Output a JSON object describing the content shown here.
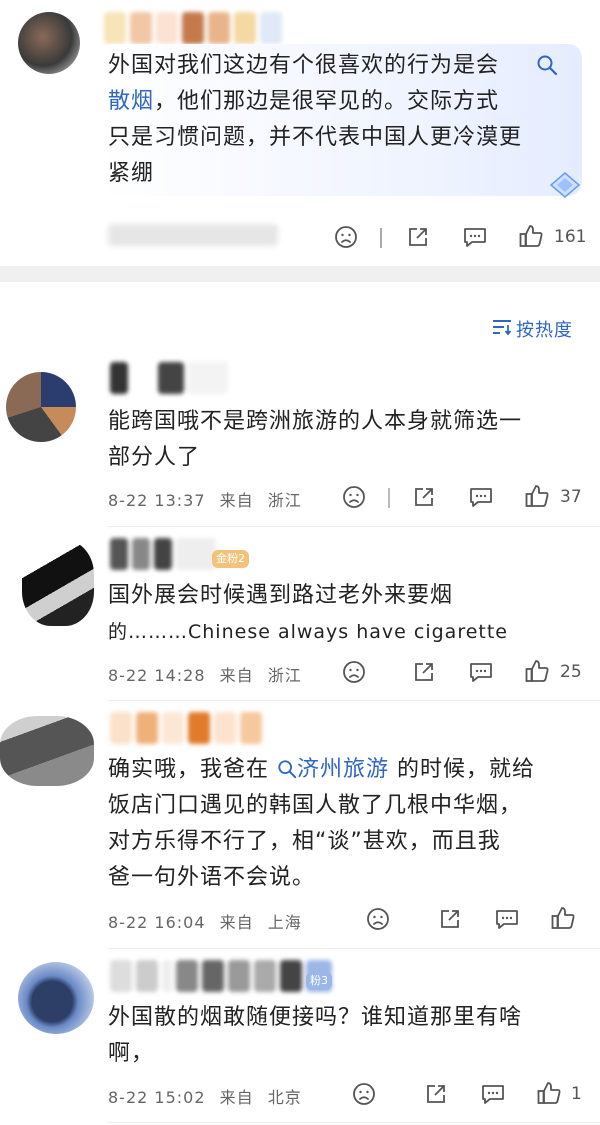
{
  "top_comment": {
    "text_line1": "外国对我们这边有个很喜欢的行为是会",
    "link_text": "散烟",
    "text_line2_rest": "，他们那边是很罕见的。交际方式",
    "text_line3": "只是习惯问题，并不代表中国人更冷漠更",
    "text_line4": "紧绷",
    "like_count": "161"
  },
  "sort": {
    "label": "按热度"
  },
  "comments": [
    {
      "line1": "能跨国哦不是跨洲旅游的人本身就筛选一",
      "line2": "部分人了",
      "date": "8-22 13:37",
      "from_label": "来自",
      "location": "浙江",
      "likes": "37"
    },
    {
      "badge": "金粉2",
      "line1": "国外展会时候遇到路过老外来要烟",
      "line2": "的………Chinese always have cigarette",
      "date": "8-22 14:28",
      "from_label": "来自",
      "location": "浙江",
      "likes": "25"
    },
    {
      "line1_prefix": "确实哦，我爸在",
      "link_text": "济州旅游",
      "line1_suffix": "的时候，就给",
      "line2": "饭店门口遇见的韩国人散了几根中华烟，",
      "line3": "对方乐得不行了，相“谈”甚欢，而且我",
      "line4": "爸一句外语不会说。",
      "date": "8-22 16:04",
      "from_label": "来自",
      "location": "上海",
      "likes": ""
    },
    {
      "badge": "粉3",
      "line1": "外国散的烟敢随便接吗？谁知道那里有啥",
      "line2": "啊，",
      "date": "8-22 15:02",
      "from_label": "来自",
      "location": "北京",
      "likes": "1"
    }
  ],
  "colors": {
    "link": "#2f66c6",
    "meta": "#666666",
    "badge": "#f2c27a",
    "bubble": "#eef3ff"
  },
  "icons": [
    "sad-face-icon",
    "share-icon",
    "comment-icon",
    "thumbs-up-icon",
    "search-icon",
    "sort-icon",
    "diamond-icon"
  ]
}
